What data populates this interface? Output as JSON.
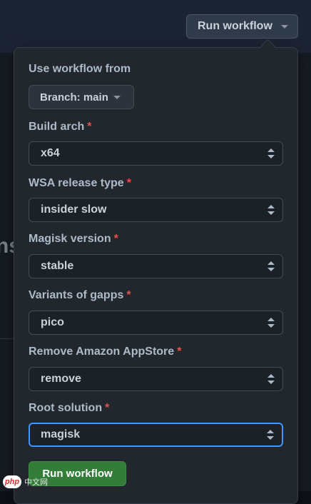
{
  "header": {
    "run_button_label": "Run workflow"
  },
  "background": {
    "partial_heading": "ns"
  },
  "form": {
    "use_workflow_from_label": "Use workflow from",
    "branch_button_label": "Branch: main",
    "fields": [
      {
        "label": "Build arch",
        "required": true,
        "value": "x64"
      },
      {
        "label": "WSA release type",
        "required": true,
        "value": "insider slow"
      },
      {
        "label": "Magisk version",
        "required": true,
        "value": "stable"
      },
      {
        "label": "Variants of gapps",
        "required": true,
        "value": "pico"
      },
      {
        "label": "Remove Amazon AppStore",
        "required": true,
        "value": "remove"
      },
      {
        "label": "Root solution",
        "required": true,
        "value": "magisk"
      }
    ],
    "required_marker": "*",
    "submit_label": "Run workflow"
  },
  "watermark": {
    "logo_text": "php",
    "site_text": "中文网"
  },
  "icons": {
    "dropdown": "caret-down-icon",
    "select_arrows": "up-down-arrows-icon"
  },
  "colors": {
    "primary_green": "#347d39",
    "focus_blue": "#4493f8",
    "required_red": "#e5534b"
  }
}
